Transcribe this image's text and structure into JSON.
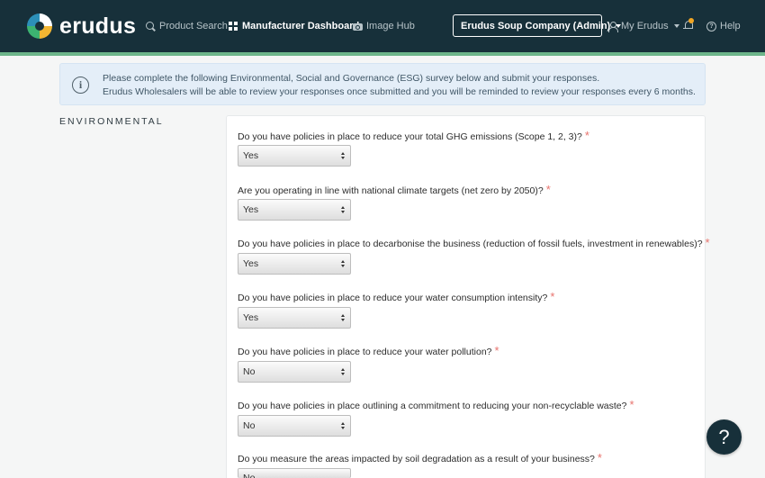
{
  "brand": {
    "name": "erudus"
  },
  "nav": {
    "product_search": "Product Search",
    "manufacturer_dashboard": "Manufacturer Dashboard",
    "image_hub": "Image Hub",
    "company_select": "Erudus Soup Company (Admin)",
    "my_account": "My Erudus",
    "help": "Help"
  },
  "alert": {
    "icon": "info-icon",
    "line1": "Please complete the following Environmental, Social and Governance (ESG) survey below and submit your responses.",
    "line2": "Erudus Wholesalers will be able to review your responses once submitted and you will be reminded to review your responses every 6 months."
  },
  "section": {
    "title": "ENVIRONMENTAL"
  },
  "questions": [
    {
      "text": "Do you have policies in place to reduce your total GHG emissions (Scope 1, 2, 3)?",
      "answer": "Yes"
    },
    {
      "text": "Are you operating in line with national climate targets (net zero by 2050)?",
      "answer": "Yes"
    },
    {
      "text": "Do you have policies in place to decarbonise the business (reduction of fossil fuels, investment in renewables)?",
      "answer": "Yes"
    },
    {
      "text": "Do you have policies in place to reduce your water consumption intensity?",
      "answer": "Yes"
    },
    {
      "text": "Do you have policies in place to reduce your water pollution?",
      "answer": "No"
    },
    {
      "text": "Do you have policies in place outlining a commitment to reducing your non-recyclable waste?",
      "answer": "No"
    },
    {
      "text": "Do you measure the areas impacted by soil degradation as a result of your business?",
      "answer": "No"
    }
  ],
  "required_mark": "*",
  "help_fab": "?",
  "colors": {
    "topbar": "#17303a",
    "accent": "#6db58a",
    "required": "#e8736d",
    "alert_bg": "#e4eef8"
  }
}
